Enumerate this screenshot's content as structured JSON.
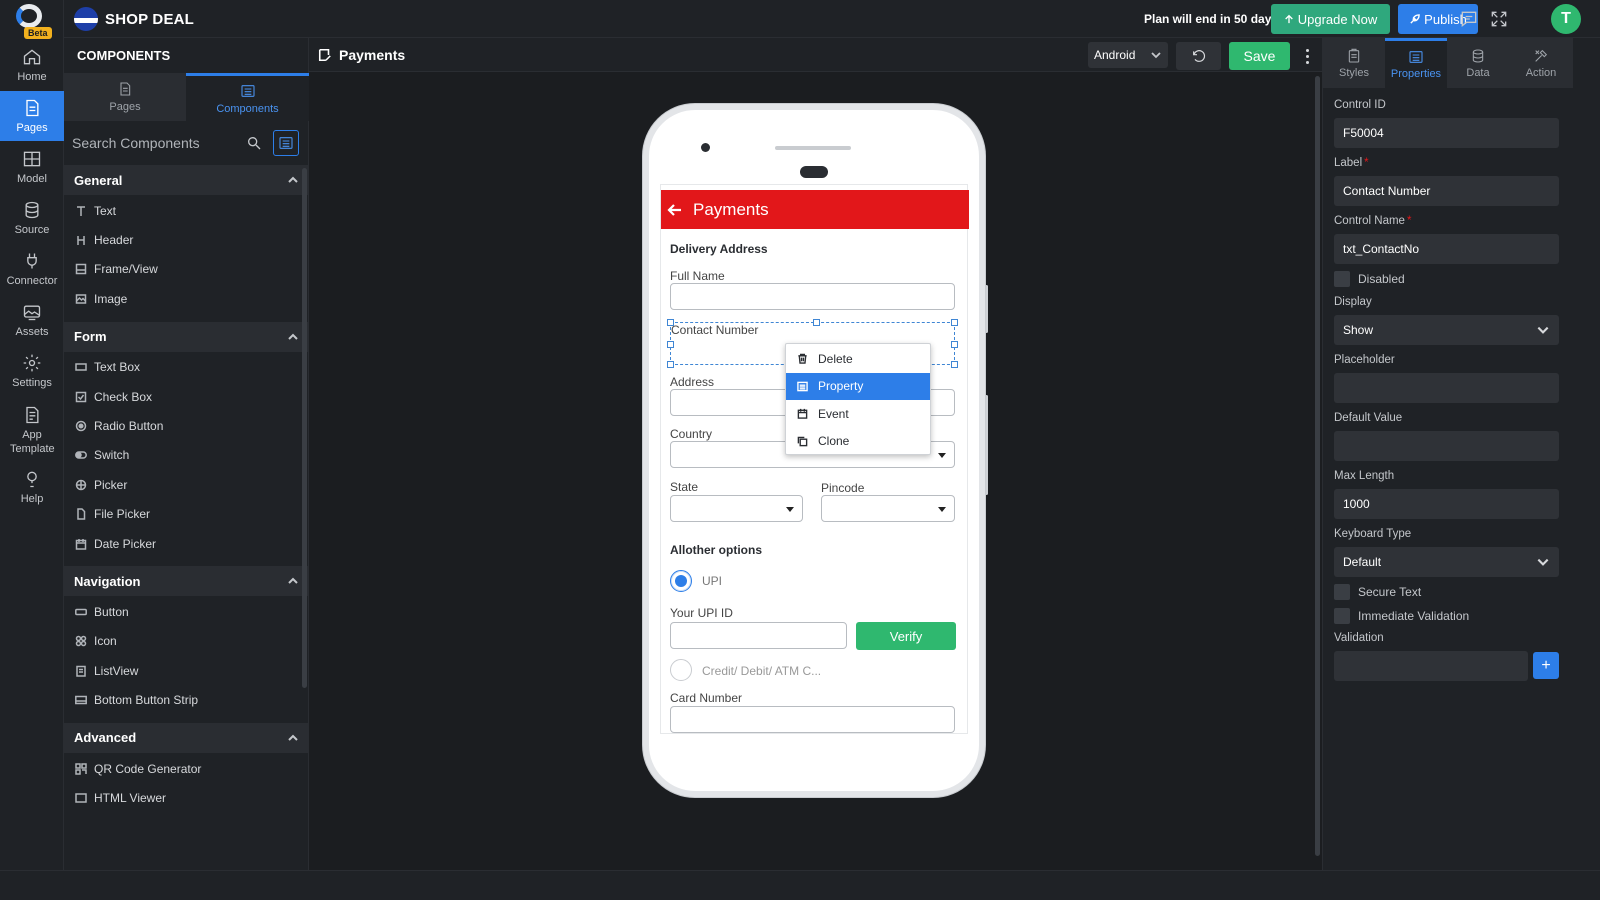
{
  "app": {
    "name": "SHOP DEAL",
    "plan_notice": "Plan will end in 50 days",
    "upgrade_label": "Upgrade Now",
    "publish_label": "Publish",
    "avatar_letter": "T"
  },
  "rail": {
    "beta": "Beta",
    "items": [
      {
        "label": "Home",
        "icon": "home-icon"
      },
      {
        "label": "Pages",
        "icon": "page-icon"
      },
      {
        "label": "Model",
        "icon": "grid-icon"
      },
      {
        "label": "Source",
        "icon": "database-icon"
      },
      {
        "label": "Connector",
        "icon": "plug-icon"
      },
      {
        "label": "Assets",
        "icon": "image-icon"
      },
      {
        "label": "Settings",
        "icon": "gear-icon"
      },
      {
        "label": "App Template",
        "icon": "template-icon"
      },
      {
        "label": "Help",
        "icon": "help-icon"
      }
    ]
  },
  "components": {
    "title": "COMPONENTS",
    "tabs": [
      {
        "label": "Pages"
      },
      {
        "label": "Components"
      }
    ],
    "search_placeholder": "Search Components",
    "sections": [
      {
        "title": "General",
        "items": [
          "Text",
          "Header",
          "Frame/View",
          "Image"
        ]
      },
      {
        "title": "Form",
        "items": [
          "Text Box",
          "Check Box",
          "Radio Button",
          "Switch",
          "Picker",
          "File Picker",
          "Date Picker"
        ]
      },
      {
        "title": "Navigation",
        "items": [
          "Button",
          "Icon",
          "ListView",
          "Bottom Button Strip"
        ]
      },
      {
        "title": "Advanced",
        "items": [
          "QR Code Generator",
          "HTML Viewer"
        ]
      }
    ]
  },
  "canvas": {
    "page_name": "Payments",
    "device": "Android",
    "save_label": "Save"
  },
  "phone": {
    "header_title": "Payments",
    "delivery_title": "Delivery Address",
    "full_name_label": "Full Name",
    "contact_label": "Contact Number",
    "address_label": "Address",
    "country_label": "Country",
    "state_label": "State",
    "pincode_label": "Pincode",
    "other_title": "Allother options",
    "upi_label": "UPI",
    "upi_id_label": "Your UPI ID",
    "verify_label": "Verify",
    "card_option_label": "Credit/ Debit/ ATM C...",
    "card_number_label": "Card Number"
  },
  "context_menu": {
    "items": [
      "Delete",
      "Property",
      "Event",
      "Clone"
    ],
    "active": "Property"
  },
  "properties": {
    "tabs": [
      "Styles",
      "Properties",
      "Data",
      "Action"
    ],
    "active_tab": "Properties",
    "control_id_label": "Control ID",
    "control_id": "F50004",
    "label_label": "Label",
    "label_value": "Contact Number",
    "control_name_label": "Control Name",
    "control_name": "txt_ContactNo",
    "disabled_label": "Disabled",
    "display_label": "Display",
    "display_value": "Show",
    "placeholder_label": "Placeholder",
    "placeholder_value": "",
    "default_label": "Default Value",
    "default_value": "",
    "maxlen_label": "Max Length",
    "maxlen_value": "1000",
    "keyboard_label": "Keyboard Type",
    "keyboard_value": "Default",
    "secure_label": "Secure Text",
    "immediate_label": "Immediate Validation",
    "validation_label": "Validation",
    "validation_value": "",
    "required_mark": "*"
  },
  "colors": {
    "accent": "#2d7ee8",
    "success": "#2fb86f",
    "header_red": "#e2171a",
    "upgrade": "#2fa87d"
  }
}
